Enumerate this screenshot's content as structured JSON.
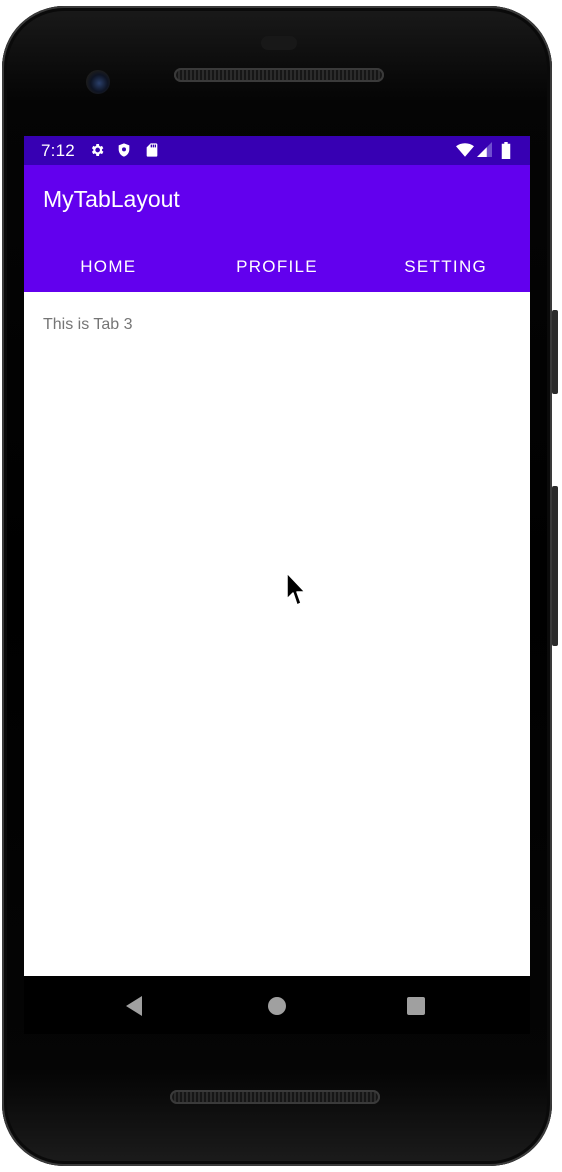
{
  "status_bar": {
    "time": "7:12",
    "left_icons": [
      "settings-icon",
      "shield-icon",
      "sd-card-icon"
    ],
    "right_icons": [
      "wifi-icon",
      "cell-signal-icon",
      "battery-icon"
    ],
    "color": "#3700b3"
  },
  "app_bar": {
    "title": "MyTabLayout",
    "color": "#6200ee"
  },
  "tabs": [
    {
      "label": "HOME"
    },
    {
      "label": "PROFILE"
    },
    {
      "label": "SETTING"
    }
  ],
  "content": {
    "text": "This is Tab 3"
  },
  "nav_bar": {
    "buttons": [
      "back-icon",
      "home-icon",
      "recents-icon"
    ]
  }
}
